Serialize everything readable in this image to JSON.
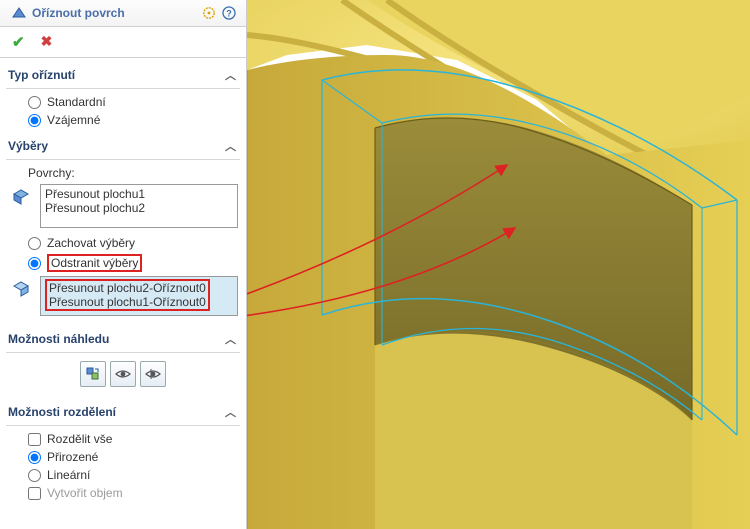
{
  "header": {
    "title": "Oříznout povrch"
  },
  "section_type": {
    "title": "Typ oříznutí",
    "option_standard": "Standardní",
    "option_mutual": "Vzájemné"
  },
  "section_selections": {
    "title": "Výběry",
    "surfaces_label": "Povrchy:",
    "surfaces_items": [
      "Přesunout plochu1",
      "Přesunout plochu2"
    ],
    "option_keep": "Zachovat výběry",
    "option_remove": "Odstranit výběry",
    "remove_items": [
      "Přesunout plochu2-Oříznout0",
      "Přesunout plochu1-Oříznout0"
    ]
  },
  "section_preview": {
    "title": "Možnosti náhledu"
  },
  "section_split": {
    "title": "Možnosti rozdělení",
    "check_split_all": "Rozdělit vše",
    "option_natural": "Přirozené",
    "option_linear": "Lineární",
    "check_create_solid": "Vytvořit objem"
  }
}
